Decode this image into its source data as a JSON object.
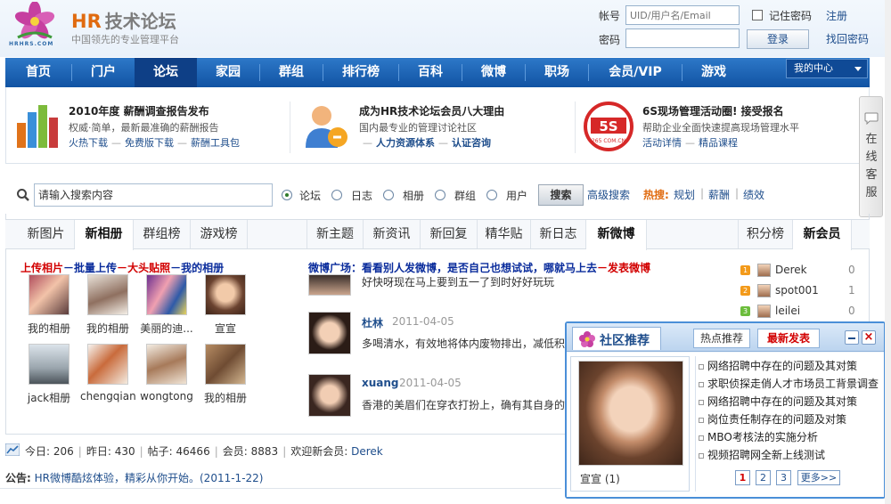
{
  "header": {
    "brand": "HR",
    "brand_sub": "技术论坛",
    "slogan": "中国领先的专业管理平台",
    "logo_url_text": "HRHRS.COM",
    "login": {
      "account_label": "帐号",
      "account_placeholder": "UID/用户名/Email",
      "password_label": "密码",
      "remember_label": "记住密码",
      "register_link": "注册",
      "login_button": "登录",
      "forgot_link": "找回密码"
    }
  },
  "nav": {
    "items": [
      "首页",
      "门户",
      "论坛",
      "家园",
      "群组",
      "排行榜",
      "百科",
      "微博",
      "职场",
      "会员/VIP",
      "游戏"
    ],
    "active_index": 2,
    "my_center": "我的中心"
  },
  "promos": [
    {
      "title": "2010年度 薪酬调查报告发布",
      "desc": "权威·简单，最新最准确的薪酬报告",
      "links": [
        "火热下载",
        "免费版下载",
        "薪酬工具包"
      ]
    },
    {
      "title": "成为HR技术论坛会员八大理由",
      "desc": "国内最专业的管理讨论社区",
      "links": [
        "人力资源体系",
        "认证咨询"
      ]
    },
    {
      "title": "6S现场管理活动圈! 接受报名",
      "desc": "帮助企业全面快速提高现场管理水平",
      "links": [
        "活动详情",
        "精品课程"
      ],
      "logo_text": "5S",
      "logo_sub": "265 COM.CN"
    }
  ],
  "side_tab": {
    "label": "在线客服"
  },
  "search": {
    "placeholder": "请输入搜索内容",
    "options": [
      "论坛",
      "日志",
      "相册",
      "群组",
      "用户"
    ],
    "selected": "论坛",
    "button": "搜索",
    "advanced": "高级搜索",
    "hot_label": "热搜:",
    "hot_terms": [
      "规划",
      "薪酬",
      "绩效"
    ]
  },
  "tabs": {
    "left": [
      "新图片",
      "新相册",
      "群组榜",
      "游戏榜"
    ],
    "left_active": "新相册",
    "middle": [
      "新主题",
      "新资讯",
      "新回复",
      "精华贴",
      "新日志",
      "新微博"
    ],
    "middle_active": "新微博",
    "right": [
      "积分榜",
      "新会员"
    ],
    "right_active": "新会员"
  },
  "albums": {
    "promo_line": [
      "上传相片",
      "批量上传",
      "大头贴照",
      "我的相册"
    ],
    "items": [
      {
        "caption": "我的相册"
      },
      {
        "caption": "我的相册"
      },
      {
        "caption": "美丽的迪..."
      },
      {
        "caption": "宣宣"
      },
      {
        "caption": "jack相册"
      },
      {
        "caption": "chengqiang"
      },
      {
        "caption": "wongtong"
      },
      {
        "caption": "我的相册"
      }
    ]
  },
  "weibo": {
    "headline_prefix": "微博广场：看看别人发微博，是否自己也想试试，哪就马上去",
    "headline_action": "发表微博",
    "posts": [
      {
        "user": "",
        "date": "",
        "text": "好快呀现在马上要到五一了到时好好玩玩"
      },
      {
        "user": "杜林",
        "date": "2011-04-05",
        "text": "多喝清水，有效地将体内废物排出，减低积"
      },
      {
        "user": "xuang",
        "date": "2011-04-05",
        "text": "香港的美眉们在穿衣打扮上，确有其自身的"
      }
    ]
  },
  "members": [
    {
      "rank": "1",
      "name": "Derek",
      "score": "0"
    },
    {
      "rank": "2",
      "name": "spot001",
      "score": "1"
    },
    {
      "rank": "3",
      "name": "leilei",
      "score": "0"
    }
  ],
  "stats": {
    "today_label": "今日:",
    "today": "206",
    "yesterday_label": "昨日:",
    "yesterday": "430",
    "posts_label": "帖子:",
    "posts": "46466",
    "members_label": "会员:",
    "members": "8883",
    "welcome_label": "欢迎新会员:",
    "newest": "Derek"
  },
  "notice": {
    "label": "公告:",
    "text": "HR微博酷炫体验，精彩从你开始。(2011-1-22)"
  },
  "popup": {
    "title": "社区推荐",
    "tab_hot": "热点推荐",
    "tab_new": "最新发表",
    "featured_caption": "宣宣 (1)",
    "list": [
      "网络招聘中存在的问题及其对策",
      "求职侦探走俏人才市场员工背景调查",
      "网络招聘中存在的问题及其对策",
      "岗位责任制存在的问题及对策",
      "MBO考核法的实施分析",
      "视频招聘网全新上线测试"
    ],
    "pages": [
      "1",
      "2",
      "3"
    ],
    "current_page": "1",
    "more": "更多>>"
  },
  "colors": {
    "nav_bg": "#1a62b4",
    "brand_orange": "#e06b10",
    "link_blue": "#1f4e8c",
    "alert_red": "#d20000"
  }
}
